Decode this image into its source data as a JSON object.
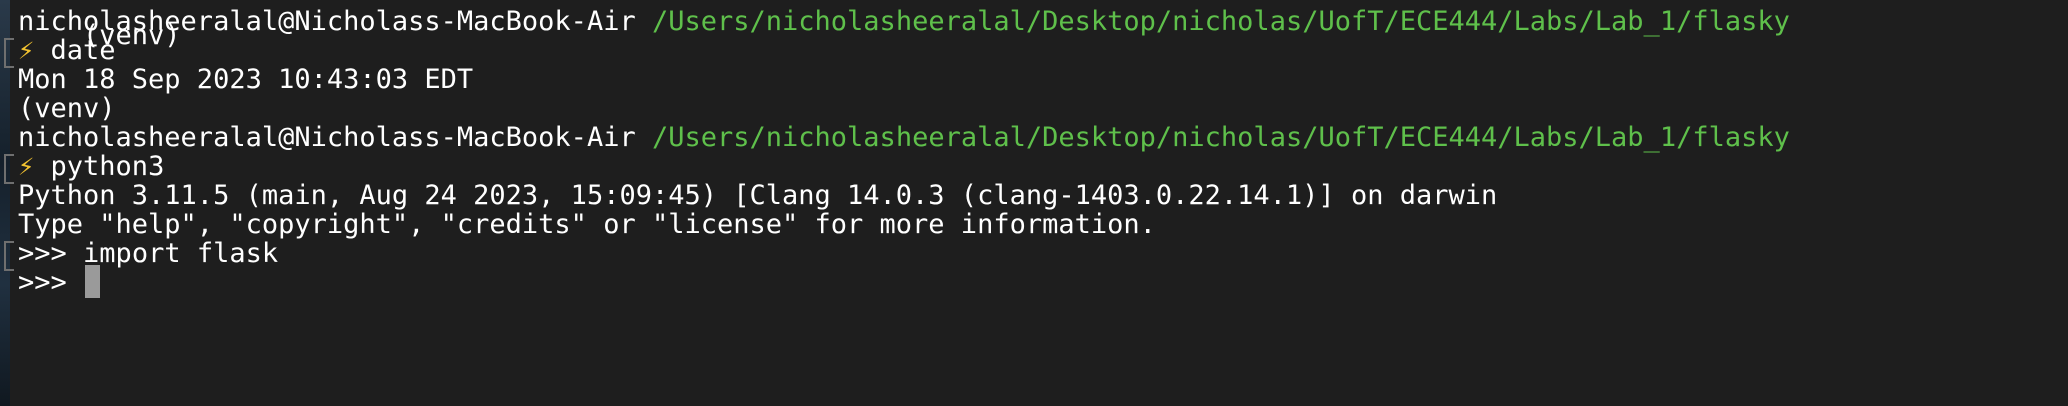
{
  "terminal": {
    "lines": {
      "top_partial": "(venv)",
      "prompt1_user": "nicholasheeralal@Nicholass-MacBook-Air",
      "prompt1_path": "/Users/nicholasheeralal/Desktop/nicholas/UofT/ECE444/Labs/Lab_1/flasky",
      "cmd1_symbol": "⚡",
      "cmd1_text": "date",
      "out1": "Mon 18 Sep 2023 10:43:03 EDT",
      "venv": "(venv)",
      "prompt2_user": "nicholasheeralal@Nicholass-MacBook-Air",
      "prompt2_path": "/Users/nicholasheeralal/Desktop/nicholas/UofT/ECE444/Labs/Lab_1/flasky",
      "cmd2_symbol": "⚡",
      "cmd2_text": "python3",
      "out2": "Python 3.11.5 (main, Aug 24 2023, 15:09:45) [Clang 14.0.3 (clang-1403.0.22.14.1)] on darwin",
      "out3": "Type \"help\", \"copyright\", \"credits\" or \"license\" for more information.",
      "repl1_prompt": ">>>",
      "repl1_text": "import flask",
      "repl2_prompt": ">>>"
    },
    "colors": {
      "background": "#1e1e1e",
      "text": "#ffffff",
      "path": "#5fc04b",
      "bolt": "#f2c230",
      "cursor": "#9a9a9a"
    }
  }
}
